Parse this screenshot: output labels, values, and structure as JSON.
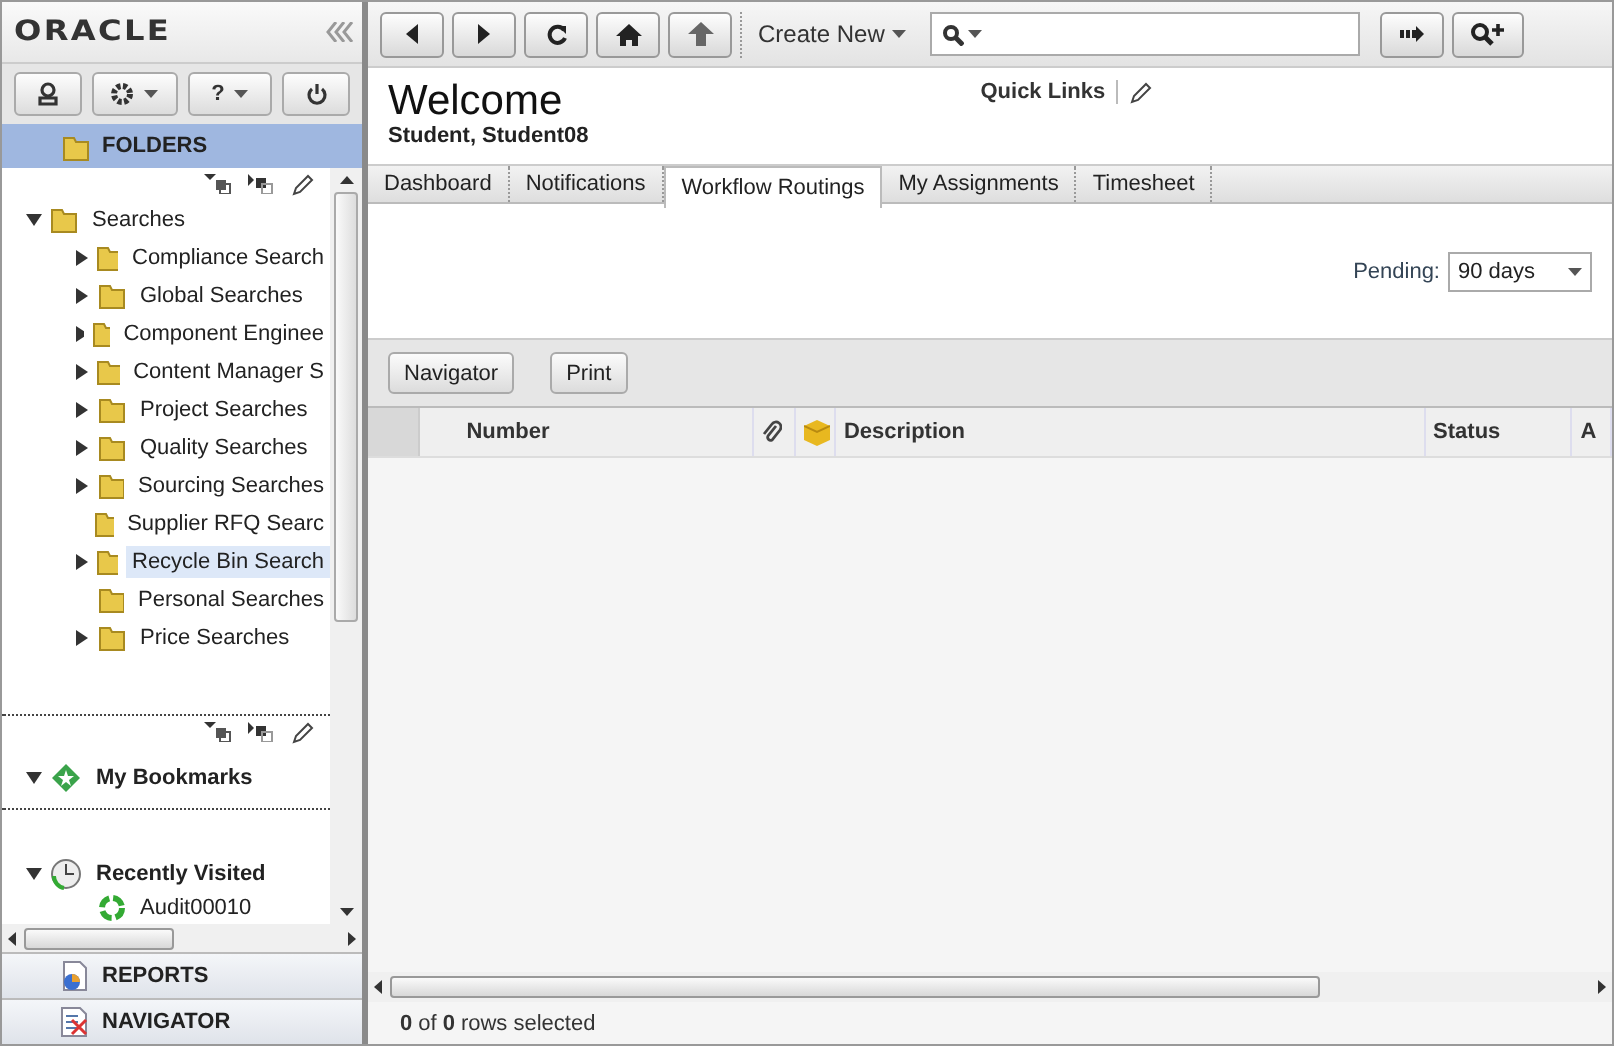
{
  "sidebar": {
    "logo": "ORACLE",
    "toolbar": [
      {
        "kind": "user"
      },
      {
        "kind": "gear",
        "menu": true
      },
      {
        "kind": "help",
        "label": "?",
        "menu": true
      },
      {
        "kind": "power"
      }
    ],
    "folders_header": "FOLDERS",
    "tree": [
      {
        "label": "Searches",
        "expanded": true,
        "children": [
          {
            "label": "Compliance Search",
            "expander": true,
            "selected": false
          },
          {
            "label": "Global Searches",
            "expander": true,
            "selected": false
          },
          {
            "label": "Component Enginee",
            "expander": true,
            "selected": false
          },
          {
            "label": "Content Manager S",
            "expander": true,
            "selected": false
          },
          {
            "label": "Project Searches",
            "expander": true,
            "selected": false
          },
          {
            "label": "Quality Searches",
            "expander": true,
            "selected": false
          },
          {
            "label": "Sourcing Searches",
            "expander": true,
            "selected": false
          },
          {
            "label": "Supplier RFQ Searc",
            "expander": false,
            "selected": false
          },
          {
            "label": "Recycle Bin Search",
            "expander": true,
            "selected": true
          },
          {
            "label": "Personal Searches",
            "expander": false,
            "selected": false
          },
          {
            "label": "Price Searches",
            "expander": true,
            "selected": false
          }
        ]
      }
    ],
    "bookmarks": {
      "label": "My Bookmarks",
      "expanded": true
    },
    "recent": {
      "label": "Recently Visited",
      "expanded": true,
      "items": [
        "Audit00010"
      ]
    },
    "bottom_sections": [
      {
        "kind": "reports",
        "label": "REPORTS"
      },
      {
        "kind": "navigator",
        "label": "NAVIGATOR"
      }
    ]
  },
  "toolbar": {
    "create_new": "Create New"
  },
  "header": {
    "title": "Welcome",
    "user": "Student, Student08",
    "quick_links": "Quick Links"
  },
  "tabs": [
    {
      "label": "Dashboard",
      "selected": false
    },
    {
      "label": "Notifications",
      "selected": false
    },
    {
      "label": "Workflow Routings",
      "selected": true
    },
    {
      "label": "My Assignments",
      "selected": false
    },
    {
      "label": "Timesheet",
      "selected": false
    }
  ],
  "filter": {
    "label": "Pending:",
    "value": "90 days"
  },
  "buttons": [
    "Navigator",
    "Print"
  ],
  "table": {
    "columns": [
      {
        "kind": "text",
        "label": "Number"
      },
      {
        "kind": "attachment"
      },
      {
        "kind": "object"
      },
      {
        "kind": "text",
        "label": "Description"
      },
      {
        "kind": "text",
        "label": "Status"
      },
      {
        "kind": "text",
        "label": "A"
      }
    ]
  },
  "status": {
    "selected": "0",
    "of": "of",
    "total": "0",
    "suffix": "rows selected"
  }
}
